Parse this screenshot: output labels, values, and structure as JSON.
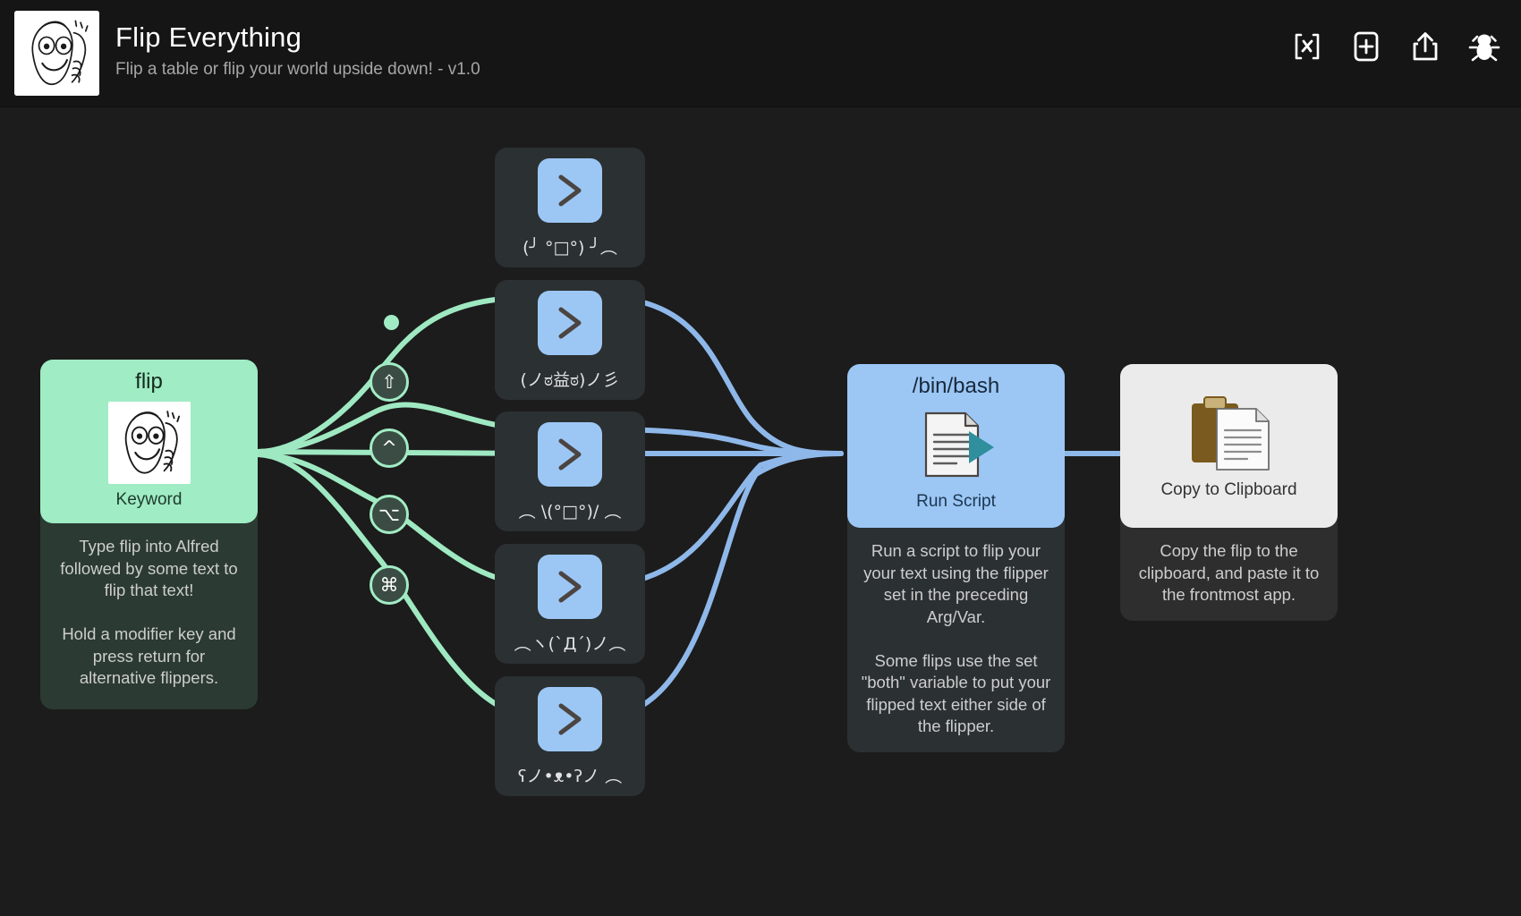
{
  "header": {
    "title": "Flip Everything",
    "subtitle": "Flip a table or flip your world upside down! - v1.0",
    "workflow_icon": "troll-face-icon",
    "actions": [
      {
        "name": "variables-icon",
        "label": "[x]"
      },
      {
        "name": "add-object-icon",
        "label": "+"
      },
      {
        "name": "share-export-icon",
        "label": "share"
      },
      {
        "name": "debug-bug-icon",
        "label": "debug"
      }
    ]
  },
  "keyword_node": {
    "title": "flip",
    "type": "Keyword",
    "icon": "troll-face-icon",
    "description": "Type flip into Alfred followed by some text to flip that text!\n\nHold a modifier key and press return for alternative flippers."
  },
  "flippers": [
    {
      "icon": "chevron-right-icon",
      "label": "(╯ °□°) ╯︵",
      "modifier": "none"
    },
    {
      "icon": "chevron-right-icon",
      "label": "(ノಠ益ಠ)ノ彡",
      "modifier": "⇧"
    },
    {
      "icon": "chevron-right-icon",
      "label": "︵ \\(°□°)/ ︵",
      "modifier": "^"
    },
    {
      "icon": "chevron-right-icon",
      "label": "︵ヽ(`Д´)ノ︵",
      "modifier": "⌥"
    },
    {
      "icon": "chevron-right-icon",
      "label": "ʕノ•ᴥ•ʔノ ︵",
      "modifier": "⌘"
    }
  ],
  "modifiers": [
    {
      "name": "modifier-shift",
      "glyph": "⇧"
    },
    {
      "name": "modifier-control",
      "glyph": "^"
    },
    {
      "name": "modifier-option",
      "glyph": "⌥"
    },
    {
      "name": "modifier-command",
      "glyph": "⌘"
    }
  ],
  "run_script_node": {
    "title": "/bin/bash",
    "type": "Run Script",
    "icon": "script-document-icon",
    "description": "Run a script to flip your your text using the flipper set in the preceding Arg/Var.\n\nSome flips use the set \"both\" variable to put your flipped text either side of the flipper."
  },
  "clipboard_node": {
    "type": "Copy to Clipboard",
    "icon": "clipboard-copy-icon",
    "description": "Copy the flip to the clipboard, and paste it to the frontmost app."
  },
  "colors": {
    "background": "#1c1c1c",
    "header_background": "#151515",
    "green_node": "#a0ecc4",
    "blue_node": "#9cc7f5",
    "white_node": "#ebebeb",
    "green_wire": "#9fe9c2",
    "blue_wire": "#8fb8ea",
    "card_background": "#2b3032"
  }
}
